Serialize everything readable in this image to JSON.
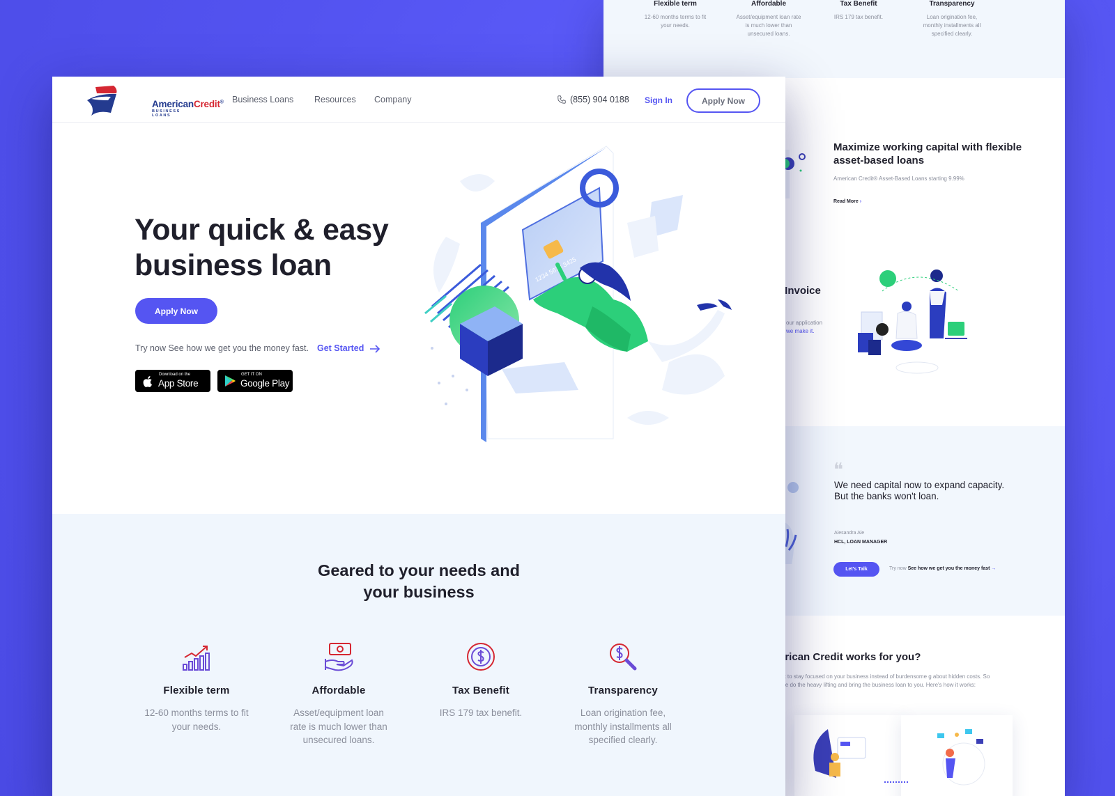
{
  "brand": {
    "name_part1": "American",
    "name_part2": "Credit",
    "registered": "®",
    "tagline": "BUSINESS LOANS"
  },
  "nav": {
    "links": [
      "Business Loans",
      "Resources",
      "Company"
    ],
    "phone": "(855) 904 0188",
    "signin": "Sign In",
    "apply": "Apply Now"
  },
  "hero": {
    "title": "Your quick & easy business loan",
    "apply": "Apply Now",
    "try_text": "Try now See how we get you the money fast.",
    "get_started": "Get Started",
    "app_store": {
      "small": "Download on the",
      "big": "App Store"
    },
    "google_play": {
      "small": "GET IT ON",
      "big": "Google Play"
    }
  },
  "features": {
    "title": "Geared to your needs and your business",
    "items": [
      {
        "icon": "bar-chart-growth-icon",
        "title": "Flexible term",
        "text": "12-60 months terms to fit your needs."
      },
      {
        "icon": "cash-in-hand-icon",
        "title": "Affordable",
        "text": "Asset/equipment loan rate is much lower than unsecured loans."
      },
      {
        "icon": "dollar-coin-icon",
        "title": "Tax Benefit",
        "text": "IRS 179 tax benefit."
      },
      {
        "icon": "magnifier-dollar-icon",
        "title": "Transparency",
        "text": "Loan origination fee, monthly installments all specified clearly."
      }
    ]
  },
  "back_page": {
    "features": [
      {
        "title": "Flexible term",
        "text": "12-60 months terms to fit your needs."
      },
      {
        "title": "Affordable",
        "text": "Asset/equipment loan rate is much lower than unsecured loans."
      },
      {
        "title": "Tax Benefit",
        "text": "IRS 179 tax benefit."
      },
      {
        "title": "Transparency",
        "text": "Loan origination fee, monthly installments all specified clearly."
      }
    ],
    "asset": {
      "title": "Maximize working capital with flexible asset-based loans",
      "sub": "American Credit® Asset-Based Loans starting 9.99%",
      "read_more": "Read More",
      "read_more_arrow": "›"
    },
    "invoice": {
      "title": "/Invoice",
      "text1": "our application",
      "text2": "we make it."
    },
    "quote": {
      "mark": "❝",
      "text": "We need capital now to expand capacity. But the banks won't loan.",
      "author": "Alesandra Ale",
      "role": "HCL, LOAN MANAGER",
      "cta": "Let's Talk",
      "try_prefix": "Try now",
      "try_bold": "See how we get you the money fast",
      "try_arrow": "→"
    },
    "works": {
      "title": "erican Credit works for you?",
      "text": "nt to stay focused on your business instead of burdensome g about hidden costs. So we do the heavy lifting and bring the business loan to you. Here's how it works:"
    }
  },
  "colors": {
    "accent": "#5555f2",
    "background": "#5555f2",
    "band": "#f0f6fd",
    "brand_red": "#d52732",
    "brand_blue": "#243b8f"
  }
}
